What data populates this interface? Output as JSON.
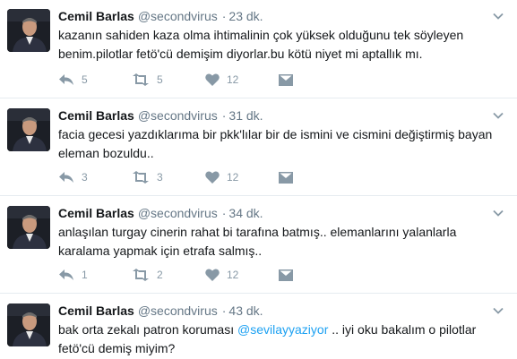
{
  "tweets": [
    {
      "author_name": "Cemil Barlas",
      "handle": "@secondvirus",
      "separator": "·",
      "time": "23 dk.",
      "text_parts": [
        "kazanın sahiden kaza olma ihtimalinin çok yüksek olduğunu tek söyleyen\nbenim.pilotlar fetö'cü demişim diyorlar.bu kötü niyet mi aptallık mı."
      ],
      "reply_count": "5",
      "retweet_count": "5",
      "like_count": "12",
      "icons": {
        "reply": "reply-icon",
        "retweet": "retweet-icon",
        "like": "heart-icon",
        "dm": "envelope-icon",
        "menu": "chevron-down-icon"
      }
    },
    {
      "author_name": "Cemil Barlas",
      "handle": "@secondvirus",
      "separator": "·",
      "time": "31 dk.",
      "text_parts": [
        "facia gecesi yazdıklarıma bir pkk'lılar bir de ismini ve cismini değiştirmiş bayan\neleman bozuldu.."
      ],
      "reply_count": "3",
      "retweet_count": "3",
      "like_count": "12",
      "icons": {
        "reply": "reply-icon",
        "retweet": "retweet-icon",
        "like": "heart-icon",
        "dm": "envelope-icon",
        "menu": "chevron-down-icon"
      }
    },
    {
      "author_name": "Cemil Barlas",
      "handle": "@secondvirus",
      "separator": "·",
      "time": "34 dk.",
      "text_parts": [
        "anlaşılan turgay cinerin rahat bi tarafına batmış.. elemanlarını yalanlarla\nkaralama yapmak için etrafa salmış.."
      ],
      "reply_count": "1",
      "retweet_count": "2",
      "like_count": "12",
      "icons": {
        "reply": "reply-icon",
        "retweet": "retweet-icon",
        "like": "heart-icon",
        "dm": "envelope-icon",
        "menu": "chevron-down-icon"
      }
    },
    {
      "author_name": "Cemil Barlas",
      "handle": "@secondvirus",
      "separator": "·",
      "time": "43 dk.",
      "text_before": "bak orta zekalı patron koruması ",
      "mention": "@sevilayyaziyor",
      "text_after": " .. iyi oku bakalım o pilotlar\nfetö'cü demiş miyim?",
      "icons": {
        "menu": "chevron-down-icon"
      }
    }
  ],
  "colors": {
    "text": "#14171a",
    "muted": "#657786",
    "action": "#8899a6",
    "link": "#1da1f2",
    "divider": "#e6ecf0"
  }
}
